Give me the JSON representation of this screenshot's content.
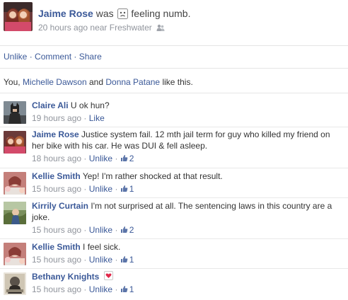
{
  "post": {
    "author": "Jaime Rose",
    "was": "was",
    "feeling": "feeling numb.",
    "feeling_icon": "sad-face-icon",
    "time": "20 hours ago",
    "near": "near",
    "location": "Freshwater",
    "audience_icon": "friends-icon"
  },
  "actions": {
    "unlike": "Unlike",
    "sep1": "·",
    "comment": "Comment",
    "sep2": "·",
    "share": "Share"
  },
  "likes": {
    "prefix": "You,",
    "person1": "Michelle Dawson",
    "and": "and",
    "person2": "Donna Patane",
    "suffix": "like this."
  },
  "comments": [
    {
      "author": "Claire Ali",
      "text": "U ok hun?",
      "time": "19 hours ago",
      "sep": "·",
      "action": "Like",
      "like_count": ""
    },
    {
      "author": "Jaime Rose",
      "text": "Justice system fail. 12 mth jail term for guy who killed my friend on her bike with his car. He was DUI & fell asleep.",
      "time": "18 hours ago",
      "sep": "·",
      "action": "Unlike",
      "sep2": "·",
      "like_count": "2"
    },
    {
      "author": "Kellie Smith",
      "text": "Yep! I'm rather shocked at that result.",
      "time": "15 hours ago",
      "sep": "·",
      "action": "Unlike",
      "sep2": "·",
      "like_count": "1"
    },
    {
      "author": "Kirrily Curtain",
      "text": "I'm not surprised at all. The sentencing laws in this country are a joke.",
      "time": "15 hours ago",
      "sep": "·",
      "action": "Unlike",
      "sep2": "·",
      "like_count": "2"
    },
    {
      "author": "Kellie Smith",
      "text": "I feel sick.",
      "time": "15 hours ago",
      "sep": "·",
      "action": "Unlike",
      "sep2": "·",
      "like_count": "1"
    },
    {
      "author": "Bethany Knights",
      "text": "",
      "time": "15 hours ago",
      "sep": "·",
      "action": "Unlike",
      "sep2": "·",
      "like_count": "1",
      "sticker_icon": "heart-icon"
    }
  ],
  "colors": {
    "link": "#3b5998",
    "meta": "#90949c",
    "divider": "#e5e5e5"
  }
}
